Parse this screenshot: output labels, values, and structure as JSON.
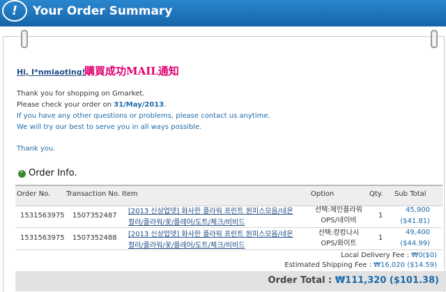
{
  "header": {
    "title": "Your Order Summary",
    "logo_glyph": "!"
  },
  "greeting": {
    "hi": "Hi, I*nmiaoting!",
    "annotation": "購買成功MAIL通知"
  },
  "message": {
    "line1": "Thank you for shopping on Gmarket.",
    "line2_prefix": "Please check your order on ",
    "line2_date": "31/May/2013",
    "line2_suffix": ".",
    "line3": "If you have any other questions or problems, please contact us anytime.",
    "line4": "We will try our best to serve you in all ways possible.",
    "thanks": "Thank you."
  },
  "section": {
    "icon": "arrow-bullet-icon",
    "title": "Order Info."
  },
  "table": {
    "headers": {
      "order_no": "Order No.",
      "transaction_no": "Transaction No.",
      "item": "Item",
      "option": "Option",
      "qty": "Qty.",
      "subtotal": "Sub Total"
    },
    "rows": [
      {
        "order_no": "1531563975",
        "transaction_no": "1507352487",
        "item_line1": "[2013 신상업뎃] 화사한 플라워 프린트 원피스모음/네온",
        "item_line2": "컬러/플라워/꽃/플레어/도트/체크/비비드",
        "option_line1": "선택:제인플라워",
        "option_line2": "OPS/네이비",
        "qty": "1",
        "price_krw": "45,900",
        "price_usd": "($41.81)"
      },
      {
        "order_no": "1531563975",
        "transaction_no": "1507352488",
        "item_line1": "[2013 신상업뎃] 화사한 플라워 프린트 원피스모음/네온",
        "item_line2": "컬러/플라워/꽃/플레어/도트/체크/비비드",
        "option_line1": "선택:캉캉나시",
        "option_line2": "OPS/화이트",
        "qty": "1",
        "price_krw": "49,400",
        "price_usd": "($44.99)"
      }
    ]
  },
  "fees": {
    "local_delivery_label": "Local Delivery Fee : ",
    "local_delivery_value": "₩0($0)",
    "shipping_label": "Estimated Shipping Fee : ",
    "shipping_value": "₩16,020 ($14.59)"
  },
  "total": {
    "label": "Order Total : ",
    "value": "₩111,320 ($101.38)"
  }
}
